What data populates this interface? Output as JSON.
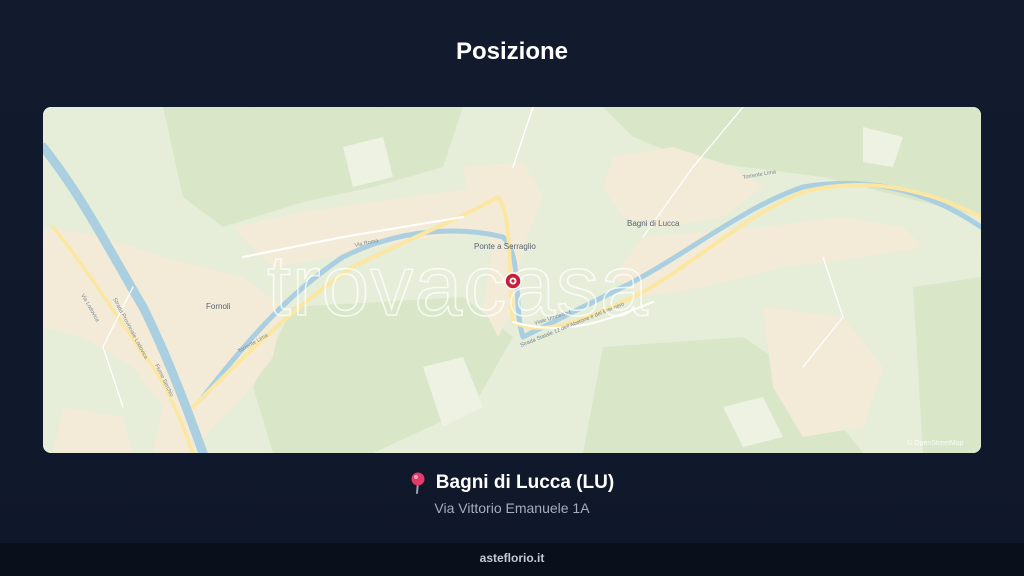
{
  "header": {
    "title": "Posizione"
  },
  "map": {
    "watermark": "trovacasa",
    "attribution": "© OpenStreetMap",
    "places": {
      "fornoli": "Fornoli",
      "ponte_a_serraglio": "Ponte a Serraglio",
      "bagni_di_lucca": "Bagni di Lucca"
    },
    "roads": {
      "strada_statale_12": "Strada Statale 12 dell'Abetone e del Brennero",
      "viale_umberto": "Viale Umberto I",
      "torrente_lima": "Torrente Lima",
      "via_roma": "Via Roma",
      "strada_lodovica": "Strada Provinciale Lodovica",
      "via_lodovica": "Via Lodovica",
      "fiume_serchio": "Fiume Serchio"
    },
    "colors": {
      "land": "#e8eedb",
      "forest": "#dbe8cc",
      "urban": "#f3ecdc",
      "river": "#a9cfe0",
      "road": "#fbe7a1",
      "marker": "#c81e3a"
    }
  },
  "location": {
    "pin_icon": "map-pin-icon",
    "name": "Bagni di Lucca (LU)",
    "address": "Via Vittorio Emanuele 1A"
  },
  "footer": {
    "site": "asteflorio.it"
  }
}
